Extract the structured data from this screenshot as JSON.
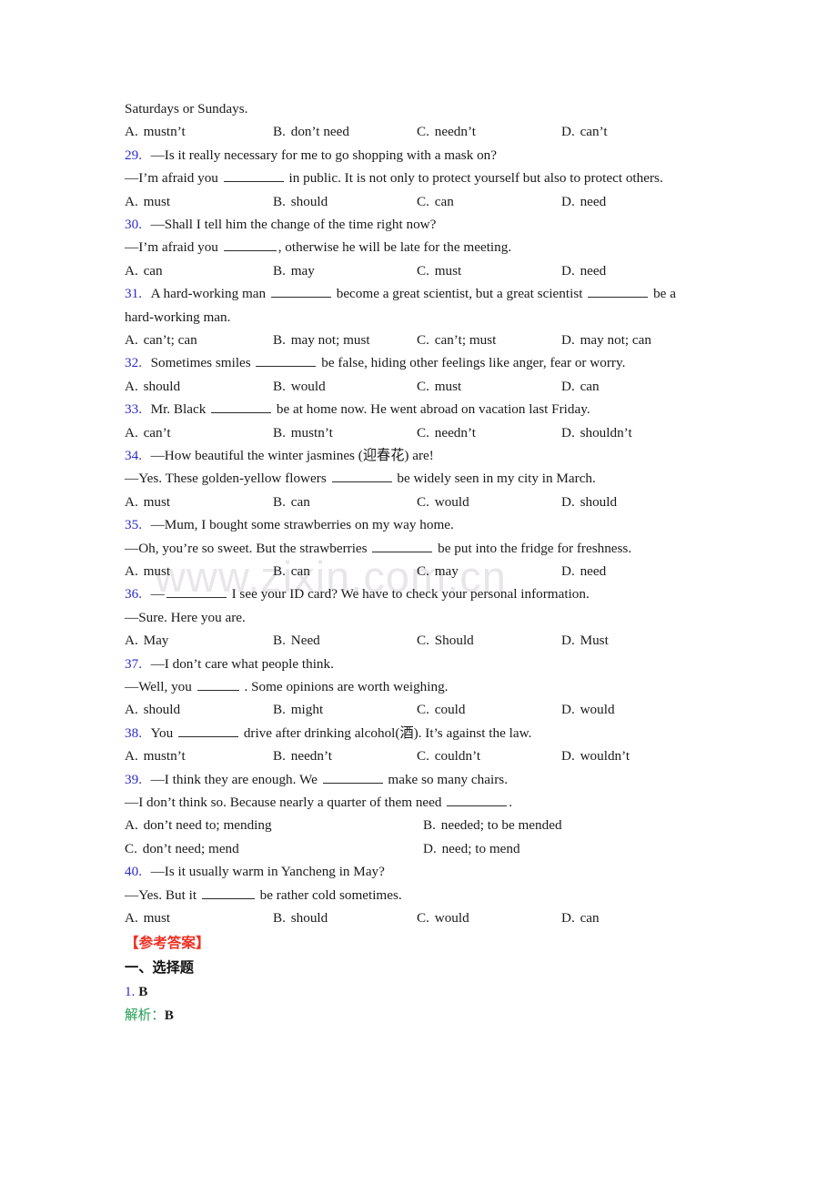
{
  "document": {
    "type": "english-grammar-exercise-worksheet",
    "watermark": "www.zixin.com.cn",
    "continued_line": "Saturdays or Sundays.",
    "colors": {
      "question_number": "#2b2bd0",
      "answer_key_heading": "#ee3124",
      "analysis_label": "#1f9b4e",
      "body_text": "#1a1a1a",
      "watermark": "#e9e6ea",
      "page_background": "#ffffff"
    }
  },
  "orphan_options": {
    "a_letter": "A",
    "a_text": "mustn’t",
    "b_letter": "B",
    "b_text": "don’t need",
    "c_letter": "C",
    "c_text": "needn’t",
    "d_letter": "D",
    "d_text": "can’t"
  },
  "questions": [
    {
      "number": "29.",
      "stem_line_1": "—Is it really necessary for me to go shopping with a mask on?",
      "stem_line_2_pre": "—I’m afraid you",
      "stem_line_2_post": "in public. It is not only to protect yourself but also to protect others.",
      "a_letter": "A",
      "a_text": "must",
      "b_letter": "B",
      "b_text": "should",
      "c_letter": "C",
      "c_text": "can",
      "d_letter": "D",
      "d_text": "need"
    },
    {
      "number": "30.",
      "stem_line_1": "—Shall I tell him the change of the time right now?",
      "stem_line_2_pre": "—I’m afraid you",
      "stem_line_2_post": ", otherwise he will be late for the meeting.",
      "a_letter": "A",
      "a_text": "can",
      "b_letter": "B",
      "b_text": "may",
      "c_letter": "C",
      "c_text": "must",
      "d_letter": "D",
      "d_text": "need"
    },
    {
      "number": "31.",
      "stem_part_1": "A hard-working man",
      "stem_part_2": "become a great scientist, but a great scientist",
      "stem_part_3": "be a",
      "stem_line_2": "hard-working man.",
      "a_letter": "A",
      "a_text": "can’t; can",
      "b_letter": "B",
      "b_text": "may not; must",
      "c_letter": "C",
      "c_text": "can’t; must",
      "d_letter": "D",
      "d_text": "may not; can"
    },
    {
      "number": "32.",
      "stem_pre": "Sometimes smiles",
      "stem_post": "be false, hiding other feelings like anger, fear or worry.",
      "a_letter": "A",
      "a_text": "should",
      "b_letter": "B",
      "b_text": "would",
      "c_letter": "C",
      "c_text": "must",
      "d_letter": "D",
      "d_text": "can"
    },
    {
      "number": "33.",
      "stem_pre": "Mr. Black",
      "stem_post": "be at home now. He went abroad on vacation last Friday.",
      "a_letter": "A",
      "a_text": "can’t",
      "b_letter": "B",
      "b_text": "mustn’t",
      "c_letter": "C",
      "c_text": "needn’t",
      "d_letter": "D",
      "d_text": "shouldn’t"
    },
    {
      "number": "34.",
      "stem_line_1": "—How beautiful the winter jasmines (迎春花) are!",
      "stem_line_2_pre": "—Yes. These golden-yellow flowers",
      "stem_line_2_post": "be widely seen in my city in March.",
      "a_letter": "A",
      "a_text": "must",
      "b_letter": "B",
      "b_text": "can",
      "c_letter": "C",
      "c_text": "would",
      "d_letter": "D",
      "d_text": "should"
    },
    {
      "number": "35.",
      "stem_line_1": "—Mum, I bought some strawberries on my way home.",
      "stem_line_2_pre": "—Oh, you’re so sweet. But the strawberries",
      "stem_line_2_post": "be put into the fridge for freshness.",
      "a_letter": "A",
      "a_text": "must",
      "b_letter": "B",
      "b_text": "can",
      "c_letter": "C",
      "c_text": "may",
      "d_letter": "D",
      "d_text": "need"
    },
    {
      "number": "36.",
      "stem_line_1_pre": "—",
      "stem_line_1_post": "I see your ID card? We have to check your personal information.",
      "stem_line_2": "—Sure. Here you are.",
      "a_letter": "A",
      "a_text": "May",
      "b_letter": "B",
      "b_text": "Need",
      "c_letter": "C",
      "c_text": "Should",
      "d_letter": "D",
      "d_text": "Must"
    },
    {
      "number": "37.",
      "stem_line_1": "—I don’t care what people think.",
      "stem_line_2_pre": "—Well, you",
      "stem_line_2_post": ". Some opinions are worth weighing.",
      "a_letter": "A",
      "a_text": "should",
      "b_letter": "B",
      "b_text": "might",
      "c_letter": "C",
      "c_text": "could",
      "d_letter": "D",
      "d_text": "would"
    },
    {
      "number": "38.",
      "stem_pre": "You",
      "stem_post": "drive after drinking alcohol(酒). It’s against the law.",
      "a_letter": "A",
      "a_text": "mustn’t",
      "b_letter": "B",
      "b_text": "needn’t",
      "c_letter": "C",
      "c_text": "couldn’t",
      "d_letter": "D",
      "d_text": "wouldn’t"
    },
    {
      "number": "39.",
      "stem_line_1_pre": "—I think they are enough. We",
      "stem_line_1_post": "make so many chairs.",
      "stem_line_2_pre": "—I don’t think so. Because nearly a quarter of them need",
      "stem_line_2_post": ".",
      "a_letter": "A",
      "a_text": "don’t need to; mending",
      "b_letter": "B",
      "b_text": "needed; to be mended",
      "c_letter": "C",
      "c_text": "don’t need; mend",
      "d_letter": "D",
      "d_text": "need; to mend"
    },
    {
      "number": "40.",
      "stem_line_1": "—Is it usually warm in Yancheng in May?",
      "stem_line_2_pre": "—Yes. But it",
      "stem_line_2_post": "be rather cold sometimes.",
      "a_letter": "A",
      "a_text": "must",
      "b_letter": "B",
      "b_text": "should",
      "c_letter": "C",
      "c_text": "would",
      "d_letter": "D",
      "d_text": "can"
    }
  ],
  "answer_key": {
    "heading": "【参考答案】",
    "section_title": "一、选择题",
    "first_answer_index": "1.",
    "first_answer_value": "B",
    "analysis_label": "解析：",
    "analysis_value": "B"
  }
}
